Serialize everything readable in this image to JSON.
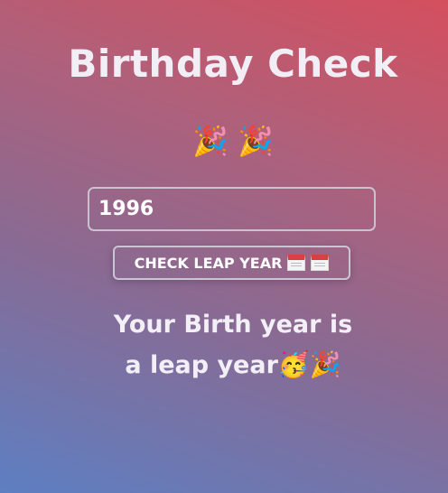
{
  "app": {
    "title": "Birthday Check",
    "header_emojis": [
      "🎉",
      "🎉"
    ]
  },
  "form": {
    "year_value": "1996",
    "button_label": "CHECK LEAP YEAR",
    "button_icons": [
      "calendar-icon",
      "calendar-icon"
    ]
  },
  "result": {
    "line1": "Your Birth year is",
    "line2": "a leap year",
    "emojis": [
      "🥳",
      "🎉"
    ]
  }
}
